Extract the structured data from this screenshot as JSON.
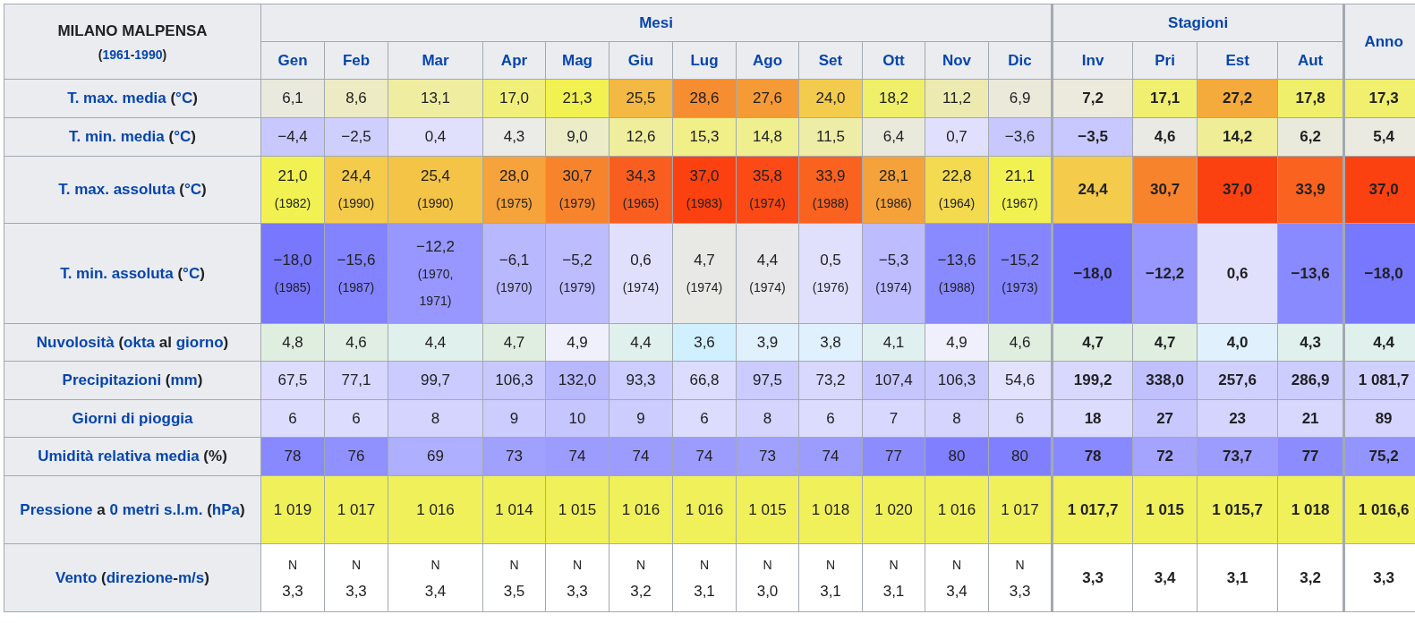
{
  "table": {
    "station": "MILANO MALPENSA",
    "period": [
      {
        "text": "(",
        "link": false
      },
      {
        "text": "1961",
        "link": true
      },
      {
        "text": "-",
        "link": false
      },
      {
        "text": "1990",
        "link": true
      },
      {
        "text": ")",
        "link": false
      }
    ],
    "months_header": "Mesi",
    "seasons_header": "Stagioni",
    "year_header": "Anno",
    "months": [
      "Gen",
      "Feb",
      "Mar",
      "Apr",
      "Mag",
      "Giu",
      "Lug",
      "Ago",
      "Set",
      "Ott",
      "Nov",
      "Dic"
    ],
    "seasons": [
      "Inv",
      "Pri",
      "Est",
      "Aut"
    ],
    "rows": [
      {
        "label": [
          {
            "text": "T. max. media",
            "link": true
          },
          {
            "text": " (",
            "link": false
          },
          {
            "text": "°C",
            "link": true
          },
          {
            "text": ")",
            "link": false
          }
        ],
        "cells": [
          {
            "value": "6,1",
            "color": "#e9e9dd"
          },
          {
            "value": "8,6",
            "color": "#ecebc3"
          },
          {
            "value": "13,1",
            "color": "#efeea0"
          },
          {
            "value": "17,0",
            "color": "#f0ef7a"
          },
          {
            "value": "21,3",
            "color": "#f2f152"
          },
          {
            "value": "25,5",
            "color": "#f4b844"
          },
          {
            "value": "28,6",
            "color": "#f68d30"
          },
          {
            "value": "27,6",
            "color": "#f69a35"
          },
          {
            "value": "24,0",
            "color": "#f4cc4d"
          },
          {
            "value": "18,2",
            "color": "#f0ef6a"
          },
          {
            "value": "11,2",
            "color": "#eceab0"
          },
          {
            "value": "6,9",
            "color": "#ebeada"
          },
          {
            "value": "7,2",
            "color": "#ebeadc"
          },
          {
            "value": "17,1",
            "color": "#f0ef70"
          },
          {
            "value": "27,2",
            "color": "#f5ab3b"
          },
          {
            "value": "17,8",
            "color": "#f0ef6c"
          },
          {
            "value": "17,3",
            "color": "#f0ef6e"
          }
        ]
      },
      {
        "label": [
          {
            "text": "T. min. media",
            "link": true
          },
          {
            "text": " (",
            "link": false
          },
          {
            "text": "°C",
            "link": true
          },
          {
            "text": ")",
            "link": false
          }
        ],
        "cells": [
          {
            "value": "−4,4",
            "color": "#c8c8ff"
          },
          {
            "value": "−2,5",
            "color": "#cfcffe"
          },
          {
            "value": "0,4",
            "color": "#e0e0fc"
          },
          {
            "value": "4,3",
            "color": "#ebebe8"
          },
          {
            "value": "9,0",
            "color": "#ececc8"
          },
          {
            "value": "12,6",
            "color": "#efee9c"
          },
          {
            "value": "15,3",
            "color": "#f0ef88"
          },
          {
            "value": "14,8",
            "color": "#efef90"
          },
          {
            "value": "11,5",
            "color": "#eeeda8"
          },
          {
            "value": "6,4",
            "color": "#eaeadc"
          },
          {
            "value": "0,7",
            "color": "#e0e0fe"
          },
          {
            "value": "−3,6",
            "color": "#c8c8ff"
          },
          {
            "value": "−3,5",
            "color": "#c8c8ff"
          },
          {
            "value": "4,6",
            "color": "#eaeae4"
          },
          {
            "value": "14,2",
            "color": "#efee96"
          },
          {
            "value": "6,2",
            "color": "#eaeadc"
          },
          {
            "value": "5,4",
            "color": "#eaeae0"
          }
        ]
      },
      {
        "label": [
          {
            "text": "T. max. assoluta",
            "link": true
          },
          {
            "text": " (",
            "link": false
          },
          {
            "text": "°C",
            "link": true
          },
          {
            "text": ")",
            "link": false
          }
        ],
        "cells": [
          {
            "value": "21,0",
            "note": "(1982)",
            "color": "#f2f152"
          },
          {
            "value": "24,4",
            "note": "(1990)",
            "color": "#f4cb4a"
          },
          {
            "value": "25,4",
            "note": "(1990)",
            "color": "#f4c447"
          },
          {
            "value": "28,0",
            "note": "(1975)",
            "color": "#f5a33a"
          },
          {
            "value": "30,7",
            "note": "(1979)",
            "color": "#f7842d"
          },
          {
            "value": "34,3",
            "note": "(1965)",
            "color": "#f95e20"
          },
          {
            "value": "37,0",
            "note": "(1983)",
            "color": "#fc4110"
          },
          {
            "value": "35,8",
            "note": "(1974)",
            "color": "#fb4a16"
          },
          {
            "value": "33,9",
            "note": "(1988)",
            "color": "#fa6220"
          },
          {
            "value": "28,1",
            "note": "(1986)",
            "color": "#f6a23a"
          },
          {
            "value": "22,8",
            "note": "(1964)",
            "color": "#f3da4e"
          },
          {
            "value": "21,1",
            "note": "(1967)",
            "color": "#f2f152"
          },
          {
            "value": "24,4",
            "color": "#f4cb4a"
          },
          {
            "value": "30,7",
            "color": "#f7842d"
          },
          {
            "value": "37,0",
            "color": "#fc4110"
          },
          {
            "value": "33,9",
            "color": "#fa6220"
          },
          {
            "value": "37,0",
            "color": "#fc4111"
          }
        ]
      },
      {
        "label": [
          {
            "text": "T. min. assoluta",
            "link": true
          },
          {
            "text": " (",
            "link": false
          },
          {
            "text": "°C",
            "link": true
          },
          {
            "text": ")",
            "link": false
          }
        ],
        "cells": [
          {
            "value": "−18,0",
            "note": "(1985)",
            "color": "#7878ff"
          },
          {
            "value": "−15,6",
            "note": "(1987)",
            "color": "#8383ff"
          },
          {
            "value": "−12,2",
            "note": "(1970, 1971)",
            "color": "#9797ff"
          },
          {
            "value": "−6,1",
            "note": "(1970)",
            "color": "#b8b8ff"
          },
          {
            "value": "−5,2",
            "note": "(1979)",
            "color": "#bcbcff"
          },
          {
            "value": "0,6",
            "note": "(1974)",
            "color": "#e0e0fc"
          },
          {
            "value": "4,7",
            "note": "(1974)",
            "color": "#e8e8e4"
          },
          {
            "value": "4,4",
            "note": "(1974)",
            "color": "#e8e8ea"
          },
          {
            "value": "0,5",
            "note": "(1976)",
            "color": "#e0e0fd"
          },
          {
            "value": "−5,3",
            "note": "(1974)",
            "color": "#bcbcfe"
          },
          {
            "value": "−13,6",
            "note": "(1988)",
            "color": "#8a8aff"
          },
          {
            "value": "−15,2",
            "note": "(1973)",
            "color": "#8585ff"
          },
          {
            "value": "−18,0",
            "color": "#7878ff"
          },
          {
            "value": "−12,2",
            "color": "#9797ff"
          },
          {
            "value": "0,6",
            "color": "#e0e0fc"
          },
          {
            "value": "−13,6",
            "color": "#8a8aff"
          },
          {
            "value": "−18,0",
            "color": "#7878ff"
          }
        ]
      },
      {
        "label": [
          {
            "text": "Nuvolosità",
            "link": true
          },
          {
            "text": " (",
            "link": false
          },
          {
            "text": "okta",
            "link": true
          },
          {
            "text": " al ",
            "link": false
          },
          {
            "text": "giorno",
            "link": true
          },
          {
            "text": ")",
            "link": false
          }
        ],
        "cells": [
          {
            "value": "4,8",
            "color": "#e0eee0"
          },
          {
            "value": "4,6",
            "color": "#e0eee4"
          },
          {
            "value": "4,4",
            "color": "#e0f0ec"
          },
          {
            "value": "4,7",
            "color": "#e0eee2"
          },
          {
            "value": "4,9",
            "color": "#f0f0fc"
          },
          {
            "value": "4,4",
            "color": "#e0f0ec"
          },
          {
            "value": "3,6",
            "color": "#d0f0ff"
          },
          {
            "value": "3,9",
            "color": "#e0f0fc"
          },
          {
            "value": "3,8",
            "color": "#e0f0fc"
          },
          {
            "value": "4,1",
            "color": "#e0f0f0"
          },
          {
            "value": "4,9",
            "color": "#f0f0fc"
          },
          {
            "value": "4,6",
            "color": "#e0eee0"
          },
          {
            "value": "4,7",
            "color": "#e0eee0"
          },
          {
            "value": "4,7",
            "color": "#e0eee0"
          },
          {
            "value": "4,0",
            "color": "#e0f0fc"
          },
          {
            "value": "4,3",
            "color": "#e0f0ec"
          },
          {
            "value": "4,4",
            "color": "#e0f0ec"
          }
        ]
      },
      {
        "label": [
          {
            "text": "Precipitazioni",
            "link": true
          },
          {
            "text": " (",
            "link": false
          },
          {
            "text": "mm",
            "link": true
          },
          {
            "text": ")",
            "link": false
          }
        ],
        "cells": [
          {
            "value": "67,5",
            "color": "#dcdcff"
          },
          {
            "value": "77,1",
            "color": "#d6d6ff"
          },
          {
            "value": "99,7",
            "color": "#cbcbff"
          },
          {
            "value": "106,3",
            "color": "#c8c8ff"
          },
          {
            "value": "132,0",
            "color": "#b8b8ff"
          },
          {
            "value": "93,3",
            "color": "#cdcdff"
          },
          {
            "value": "66,8",
            "color": "#dcdcff"
          },
          {
            "value": "97,5",
            "color": "#cbcbff"
          },
          {
            "value": "73,2",
            "color": "#d8d8ff"
          },
          {
            "value": "107,4",
            "color": "#c6c6ff"
          },
          {
            "value": "106,3",
            "color": "#c8c8ff"
          },
          {
            "value": "54,6",
            "color": "#e2e2ff"
          },
          {
            "value": "199,2",
            "color": "#d8d8ff"
          },
          {
            "value": "338,0",
            "color": "#c0c0ff"
          },
          {
            "value": "257,6",
            "color": "#d0d0ff"
          },
          {
            "value": "286,9",
            "color": "#ccccff"
          },
          {
            "value": "1 081,7",
            "color": "#d0d0ff"
          }
        ]
      },
      {
        "label": [
          {
            "text": "Giorni di pioggia",
            "link": true
          }
        ],
        "cells": [
          {
            "value": "6",
            "color": "#dcdcff"
          },
          {
            "value": "6",
            "color": "#dcdcff"
          },
          {
            "value": "8",
            "color": "#d4d4ff"
          },
          {
            "value": "9",
            "color": "#ccccff"
          },
          {
            "value": "10",
            "color": "#c6c6ff"
          },
          {
            "value": "9",
            "color": "#ccccff"
          },
          {
            "value": "6",
            "color": "#dcdcff"
          },
          {
            "value": "8",
            "color": "#d4d4ff"
          },
          {
            "value": "6",
            "color": "#dcdcff"
          },
          {
            "value": "7",
            "color": "#d8d8ff"
          },
          {
            "value": "8",
            "color": "#d4d4ff"
          },
          {
            "value": "6",
            "color": "#dcdcff"
          },
          {
            "value": "18",
            "color": "#dcdcff"
          },
          {
            "value": "27",
            "color": "#c8c8ff"
          },
          {
            "value": "23",
            "color": "#d4d4ff"
          },
          {
            "value": "21",
            "color": "#d8d8ff"
          },
          {
            "value": "89",
            "color": "#d4d4ff"
          }
        ]
      },
      {
        "label": [
          {
            "text": "Umidità relativa media",
            "link": true
          },
          {
            "text": " (%)",
            "link": false
          }
        ],
        "cells": [
          {
            "value": "78",
            "color": "#8888ff"
          },
          {
            "value": "76",
            "color": "#9090ff"
          },
          {
            "value": "69",
            "color": "#afafff"
          },
          {
            "value": "73",
            "color": "#a0a0ff"
          },
          {
            "value": "74",
            "color": "#9c9cff"
          },
          {
            "value": "74",
            "color": "#9c9cff"
          },
          {
            "value": "74",
            "color": "#9c9cff"
          },
          {
            "value": "73",
            "color": "#a0a0ff"
          },
          {
            "value": "74",
            "color": "#9c9cff"
          },
          {
            "value": "77",
            "color": "#8c8cff"
          },
          {
            "value": "80",
            "color": "#8080ff"
          },
          {
            "value": "80",
            "color": "#8080ff"
          },
          {
            "value": "78",
            "color": "#8888ff"
          },
          {
            "value": "72",
            "color": "#a4a4ff"
          },
          {
            "value": "73,7",
            "color": "#9c9cff"
          },
          {
            "value": "77",
            "color": "#8c8cff"
          },
          {
            "value": "75,2",
            "color": "#9494ff"
          }
        ]
      },
      {
        "label": [
          {
            "text": "Pressione",
            "link": true
          },
          {
            "text": " a ",
            "link": false
          },
          {
            "text": "0 metri s.l.m.",
            "link": true
          },
          {
            "text": " (",
            "link": false
          },
          {
            "text": "hPa",
            "link": true
          },
          {
            "text": ")",
            "link": false
          }
        ],
        "cells": [
          {
            "value": "1 019",
            "color": "#f0f05a"
          },
          {
            "value": "1 017",
            "color": "#f0f05a"
          },
          {
            "value": "1 016",
            "color": "#f0f05a"
          },
          {
            "value": "1 014",
            "color": "#f0f05a"
          },
          {
            "value": "1 015",
            "color": "#f0f05a"
          },
          {
            "value": "1 016",
            "color": "#f0f05a"
          },
          {
            "value": "1 016",
            "color": "#f0f05a"
          },
          {
            "value": "1 015",
            "color": "#f0f05a"
          },
          {
            "value": "1 018",
            "color": "#f0f05a"
          },
          {
            "value": "1 020",
            "color": "#f0f05a"
          },
          {
            "value": "1 016",
            "color": "#f0f05a"
          },
          {
            "value": "1 017",
            "color": "#f0f05a"
          },
          {
            "value": "1 017,7",
            "color": "#f0f05a"
          },
          {
            "value": "1 015",
            "color": "#f0f05a"
          },
          {
            "value": "1 015,7",
            "color": "#f0f05a"
          },
          {
            "value": "1 018",
            "color": "#f0f05a"
          },
          {
            "value": "1 016,6",
            "color": "#f0f05a"
          }
        ]
      },
      {
        "label": [
          {
            "text": "Vento",
            "link": true
          },
          {
            "text": " (",
            "link": false
          },
          {
            "text": "direzione",
            "link": true
          },
          {
            "text": "-",
            "link": false
          },
          {
            "text": "m/s",
            "link": true
          },
          {
            "text": ")",
            "link": false
          }
        ],
        "cells": [
          {
            "direction": "N",
            "value": "3,3",
            "color": "#ffffff"
          },
          {
            "direction": "N",
            "value": "3,3",
            "color": "#ffffff"
          },
          {
            "direction": "N",
            "value": "3,4",
            "color": "#ffffff"
          },
          {
            "direction": "N",
            "value": "3,5",
            "color": "#ffffff"
          },
          {
            "direction": "N",
            "value": "3,3",
            "color": "#ffffff"
          },
          {
            "direction": "N",
            "value": "3,2",
            "color": "#ffffff"
          },
          {
            "direction": "N",
            "value": "3,1",
            "color": "#ffffff"
          },
          {
            "direction": "N",
            "value": "3,0",
            "color": "#ffffff"
          },
          {
            "direction": "N",
            "value": "3,1",
            "color": "#ffffff"
          },
          {
            "direction": "N",
            "value": "3,1",
            "color": "#ffffff"
          },
          {
            "direction": "N",
            "value": "3,4",
            "color": "#ffffff"
          },
          {
            "direction": "N",
            "value": "3,3",
            "color": "#ffffff"
          },
          {
            "value": "3,3",
            "color": "#ffffff"
          },
          {
            "value": "3,4",
            "color": "#ffffff"
          },
          {
            "value": "3,1",
            "color": "#ffffff"
          },
          {
            "value": "3,2",
            "color": "#ffffff"
          },
          {
            "value": "3,3",
            "color": "#ffffff"
          }
        ]
      }
    ]
  }
}
